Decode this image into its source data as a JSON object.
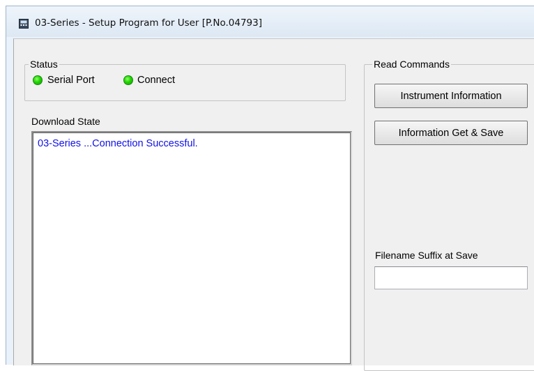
{
  "window": {
    "title": "03-Series - Setup Program for User [P.No.04793]"
  },
  "status": {
    "legend": "Status",
    "indicators": [
      {
        "label": "Serial Port",
        "color": "#22d400"
      },
      {
        "label": "Connect",
        "color": "#22d400"
      }
    ]
  },
  "download": {
    "label": "Download State",
    "log": [
      "03-Series ...Connection Successful."
    ],
    "text_color": "#1010e8"
  },
  "read_commands": {
    "legend": "Read Commands",
    "buttons": [
      "Instrument Information",
      "Information Get & Save"
    ]
  },
  "filename": {
    "label": "Filename Suffix at Save",
    "value": ""
  }
}
